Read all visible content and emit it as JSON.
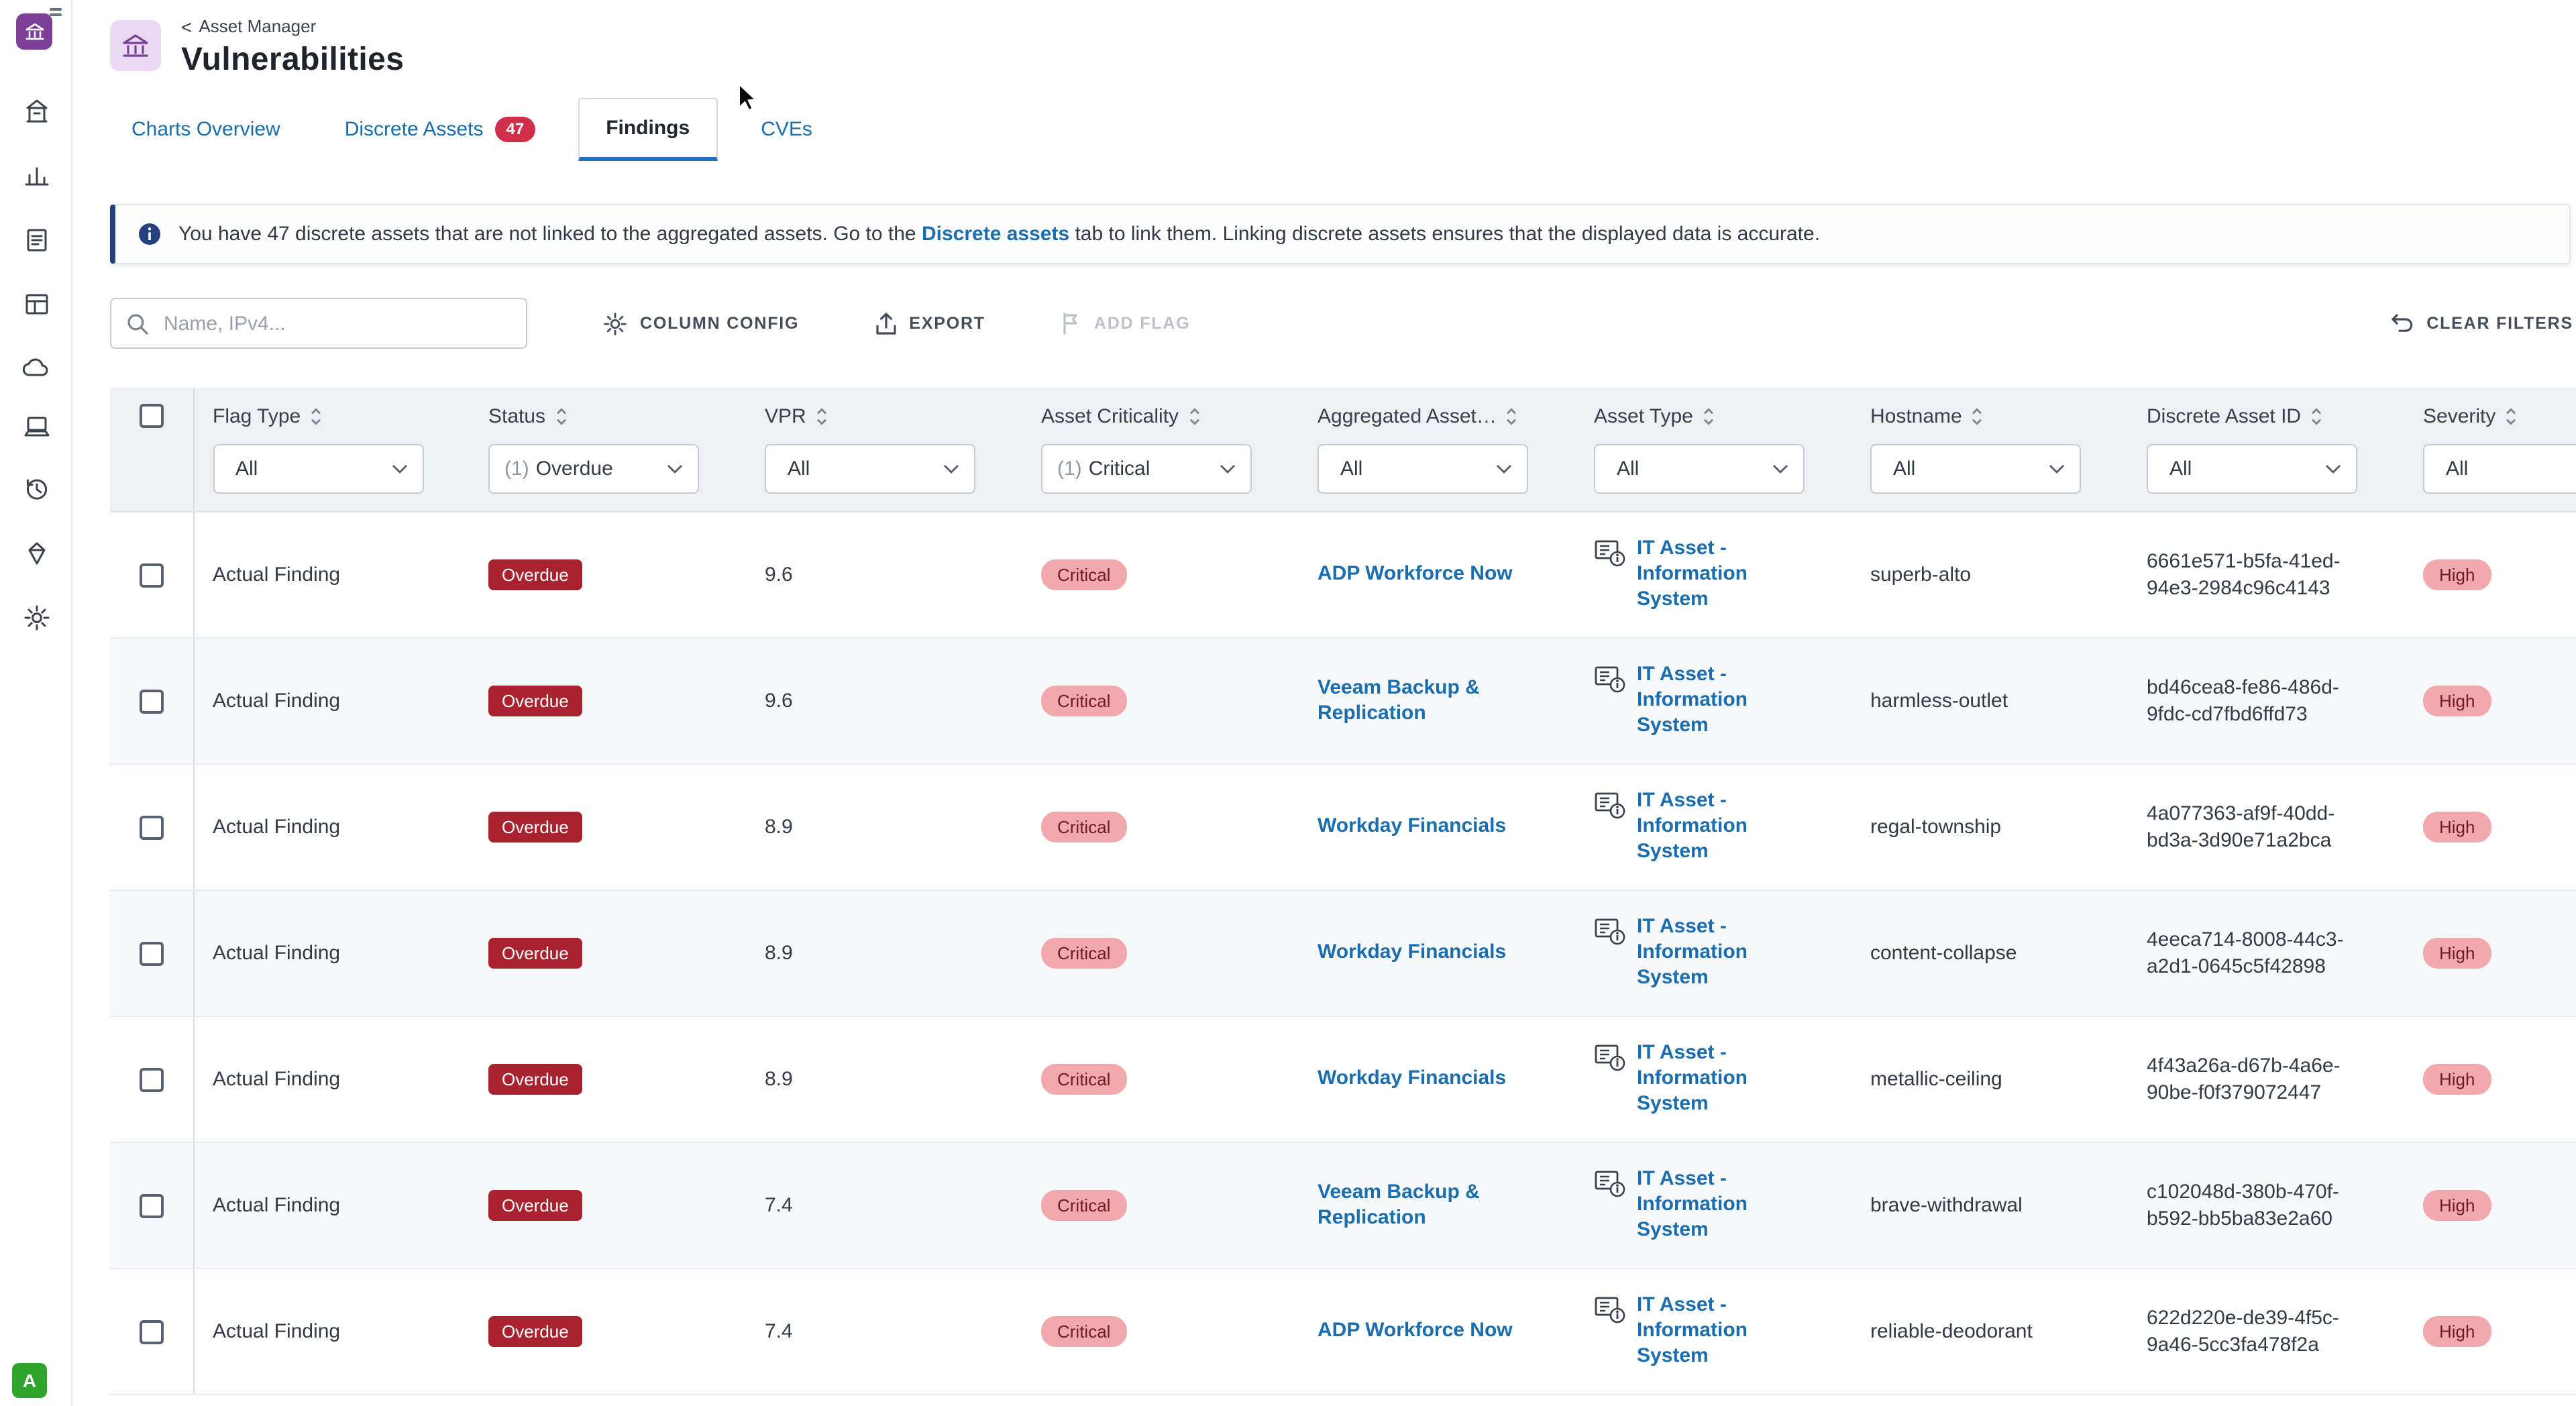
{
  "sidebar": {
    "avatar": "A"
  },
  "header": {
    "back": "Asset Manager",
    "title": "Vulnerabilities"
  },
  "tabs": {
    "charts": "Charts Overview",
    "discrete": "Discrete Assets",
    "discrete_badge": "47",
    "findings": "Findings",
    "cves": "CVEs"
  },
  "banner": {
    "before": "You have 47 discrete assets that are not linked to the aggregated assets. Go to the ",
    "link": "Discrete assets",
    "after": " tab to link them. Linking discrete assets ensures that the displayed data is accurate."
  },
  "toolbar": {
    "search_placeholder": "Name, IPv4...",
    "column_config": "COLUMN CONFIG",
    "export": "EXPORT",
    "add_flag": "ADD FLAG",
    "clear_filters": "CLEAR FILTERS"
  },
  "colors": {
    "link_blue": "#1a6dae",
    "badge_red": "#d02f4b",
    "overdue_red": "#a8232f",
    "pill_pink": "#f2a9ae",
    "pill_text": "#701a21",
    "banner_navy": "#24407f",
    "logo_purple": "#7b3f98",
    "avatar_green": "#2fa32c"
  },
  "table": {
    "columns": [
      {
        "label": "Flag Type",
        "count": "",
        "value": "All"
      },
      {
        "label": "Status",
        "count": "(1)",
        "value": "Overdue"
      },
      {
        "label": "VPR",
        "count": "",
        "value": "All"
      },
      {
        "label": "Asset Criticality",
        "count": "(1)",
        "value": "Critical"
      },
      {
        "label": "Aggregated Asset…",
        "count": "",
        "value": "All"
      },
      {
        "label": "Asset Type",
        "count": "",
        "value": "All"
      },
      {
        "label": "Hostname",
        "count": "",
        "value": "All"
      },
      {
        "label": "Discrete Asset ID",
        "count": "",
        "value": "All"
      },
      {
        "label": "Severity",
        "count": "",
        "value": "All"
      }
    ],
    "rows": [
      {
        "flag_type": "Actual Finding",
        "status": "Overdue",
        "vpr": "9.6",
        "criticality": "Critical",
        "asset": "ADP Workforce Now",
        "asset_type": "IT Asset - Information System",
        "hostname": "superb-alto",
        "asset_id": "6661e571-b5fa-41ed-94e3-2984c96c4143",
        "severity": "High"
      },
      {
        "flag_type": "Actual Finding",
        "status": "Overdue",
        "vpr": "9.6",
        "criticality": "Critical",
        "asset": "Veeam Backup & Replication",
        "asset_type": "IT Asset - Information System",
        "hostname": "harmless-outlet",
        "asset_id": "bd46cea8-fe86-486d-9fdc-cd7fbd6ffd73",
        "severity": "High"
      },
      {
        "flag_type": "Actual Finding",
        "status": "Overdue",
        "vpr": "8.9",
        "criticality": "Critical",
        "asset": "Workday Financials",
        "asset_type": "IT Asset - Information System",
        "hostname": "regal-township",
        "asset_id": "4a077363-af9f-40dd-bd3a-3d90e71a2bca",
        "severity": "High"
      },
      {
        "flag_type": "Actual Finding",
        "status": "Overdue",
        "vpr": "8.9",
        "criticality": "Critical",
        "asset": "Workday Financials",
        "asset_type": "IT Asset - Information System",
        "hostname": "content-collapse",
        "asset_id": "4eeca714-8008-44c3-a2d1-0645c5f42898",
        "severity": "High"
      },
      {
        "flag_type": "Actual Finding",
        "status": "Overdue",
        "vpr": "8.9",
        "criticality": "Critical",
        "asset": "Workday Financials",
        "asset_type": "IT Asset - Information System",
        "hostname": "metallic-ceiling",
        "asset_id": "4f43a26a-d67b-4a6e-90be-f0f379072447",
        "severity": "High"
      },
      {
        "flag_type": "Actual Finding",
        "status": "Overdue",
        "vpr": "7.4",
        "criticality": "Critical",
        "asset": "Veeam Backup & Replication",
        "asset_type": "IT Asset - Information System",
        "hostname": "brave-withdrawal",
        "asset_id": "c102048d-380b-470f-b592-bb5ba83e2a60",
        "severity": "High"
      },
      {
        "flag_type": "Actual Finding",
        "status": "Overdue",
        "vpr": "7.4",
        "criticality": "Critical",
        "asset": "ADP Workforce Now",
        "asset_type": "IT Asset - Information System",
        "hostname": "reliable-deodorant",
        "asset_id": "622d220e-de39-4f5c-9a46-5cc3fa478f2a",
        "severity": "High"
      }
    ]
  }
}
